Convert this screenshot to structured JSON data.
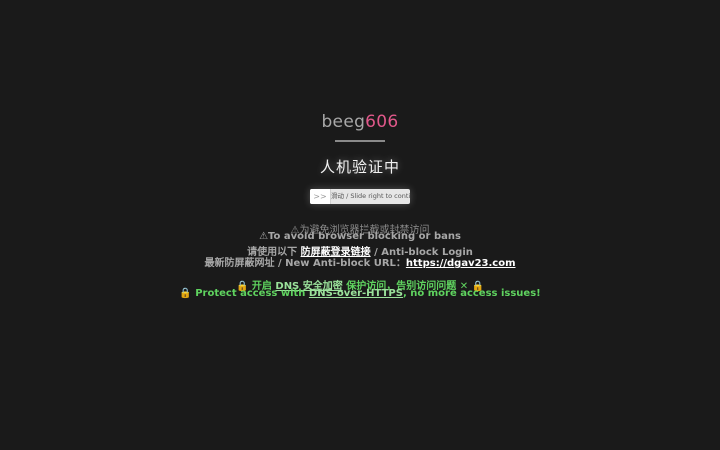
{
  "brand": {
    "part1": "beeg",
    "part2": "606"
  },
  "verify": {
    "title": "人机验证中"
  },
  "slider": {
    "handle_icon": ">>",
    "text": "滑动 / Slide right to continue"
  },
  "notice": {
    "line1": "⚠为避免浏览器拦截或封禁访问",
    "line2": "⚠To avoid browser blocking or bans",
    "line3_prefix": "请使用以下 ",
    "line3_link": "防屏蔽登录链接",
    "line3_suffix": " / Anti-block Login",
    "line4_prefix": "最新防屏蔽网址 / New Anti-block URL：",
    "line4_link": "https://dgav23.com"
  },
  "dns": {
    "line1_prefix": "🔒 开启 ",
    "line1_link": "DNS 安全加密",
    "line1_suffix": " 保护访问，告别访问问题 ✕ 🔒",
    "line2_prefix": "🔒 Protect access with ",
    "line2_link": "DNS-over-HTTPS",
    "line2_suffix": ", no more access issues!"
  },
  "colors": {
    "background": "#1a1a1a",
    "brand_accent": "#e0588a",
    "green": "#5fd35f"
  }
}
